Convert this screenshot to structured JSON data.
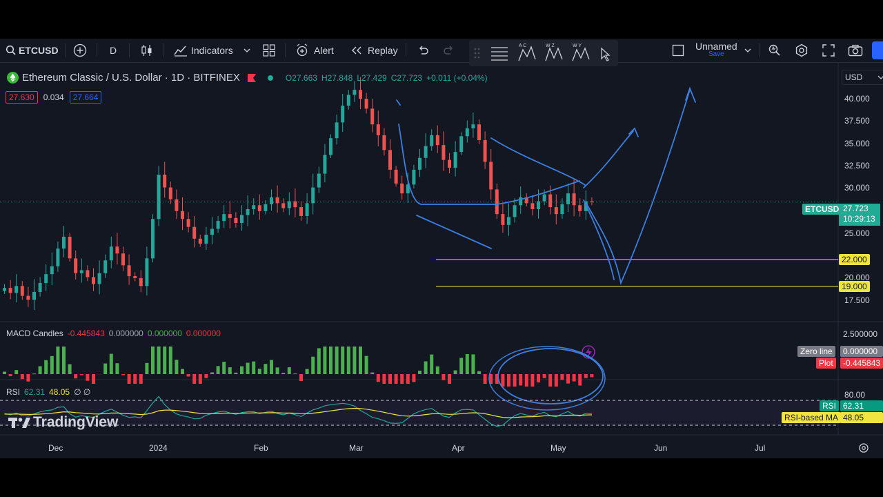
{
  "toolbar": {
    "symbol": "ETCUSD",
    "interval": "D",
    "indicators_label": "Indicators",
    "alert_label": "Alert",
    "replay_label": "Replay",
    "layout_name": "Unnamed",
    "save_label": "Save"
  },
  "legend": {
    "title": "Ethereum Classic / U.S. Dollar · 1D · BITFINEX",
    "open": "O27.663",
    "high": "H27.848",
    "low": "L27.429",
    "close": "C27.723",
    "change": "+0.011 (+0.04%)",
    "bid": "27.630",
    "spread": "0.034",
    "ask": "27.664"
  },
  "currency": "USD",
  "price_axis": [
    "40.000",
    "37.500",
    "35.000",
    "32.500",
    "30.000",
    "25.000",
    "20.000",
    "17.500"
  ],
  "current_price": {
    "symbol": "ETCUSD",
    "price": "27.723",
    "countdown": "10:29:13"
  },
  "levels": [
    "22.000",
    "19.000"
  ],
  "macd": {
    "name": "MACD Candles",
    "v1": "-0.445843",
    "v2": "0.000000",
    "v3": "0.000000",
    "v4": "0.000000",
    "axis_top": "2.500000",
    "zero_label": "Zero line",
    "zero_value": "0.000000",
    "plot_label": "Plot",
    "plot_value": "-0.445843"
  },
  "rsi": {
    "name": "RSI",
    "value": "62.31",
    "ma_value": "48.05",
    "extra": "∅ ∅",
    "axis_top": "80.00",
    "rsi_label": "RSI",
    "ma_label": "RSI-based MA"
  },
  "watermark": "TradingView",
  "time_axis": [
    "Dec",
    "2024",
    "Feb",
    "Mar",
    "Apr",
    "May",
    "Jun",
    "Jul"
  ],
  "colors": {
    "bg": "#131722",
    "up": "#26a69a",
    "down": "#ef5350",
    "drawing": "#2962ff",
    "hline": "#f0e442",
    "macd_up": "#4caf50",
    "macd_down": "#f23645"
  },
  "chart_data": {
    "type": "candlestick",
    "price_range": [
      16,
      41.5
    ],
    "series": [
      {
        "name": "ETCUSD",
        "close": [
          19,
          18.5,
          19.2,
          18.2,
          17.8,
          18.6,
          19.5,
          20.4,
          21.2,
          23,
          24.2,
          22,
          20.5,
          20.8,
          20.1,
          19.4,
          20.5,
          21.8,
          23.2,
          22.5,
          21.3,
          20.2,
          20,
          19.2,
          22,
          26,
          30.5,
          29.2,
          28,
          26.8,
          26,
          25.2,
          24,
          23.5,
          24.4,
          25,
          25.8,
          26.5,
          26.1,
          25.6,
          26.4,
          27,
          27.4,
          26.8,
          27.5,
          28.2,
          27.6,
          27.1,
          27.8,
          27.2,
          26.3,
          27.6,
          29.2,
          30.6,
          32.5,
          34.2,
          35.8,
          37.5,
          38.6,
          39.1,
          38.2,
          37.2,
          35.6,
          34.5,
          33,
          31,
          29.6,
          28.6,
          29.5,
          31,
          32.2,
          33.4,
          34.5,
          33.5,
          32,
          31.2,
          32.8,
          34.4,
          35.2,
          35.6,
          34,
          31.8,
          29,
          26.5,
          25.4,
          26.2,
          27.4,
          28.2,
          27.6,
          27,
          27.8,
          28.5,
          27.2,
          26.5,
          27.5,
          28.6,
          27.4,
          26.8,
          27.8,
          27.72
        ]
      }
    ]
  }
}
